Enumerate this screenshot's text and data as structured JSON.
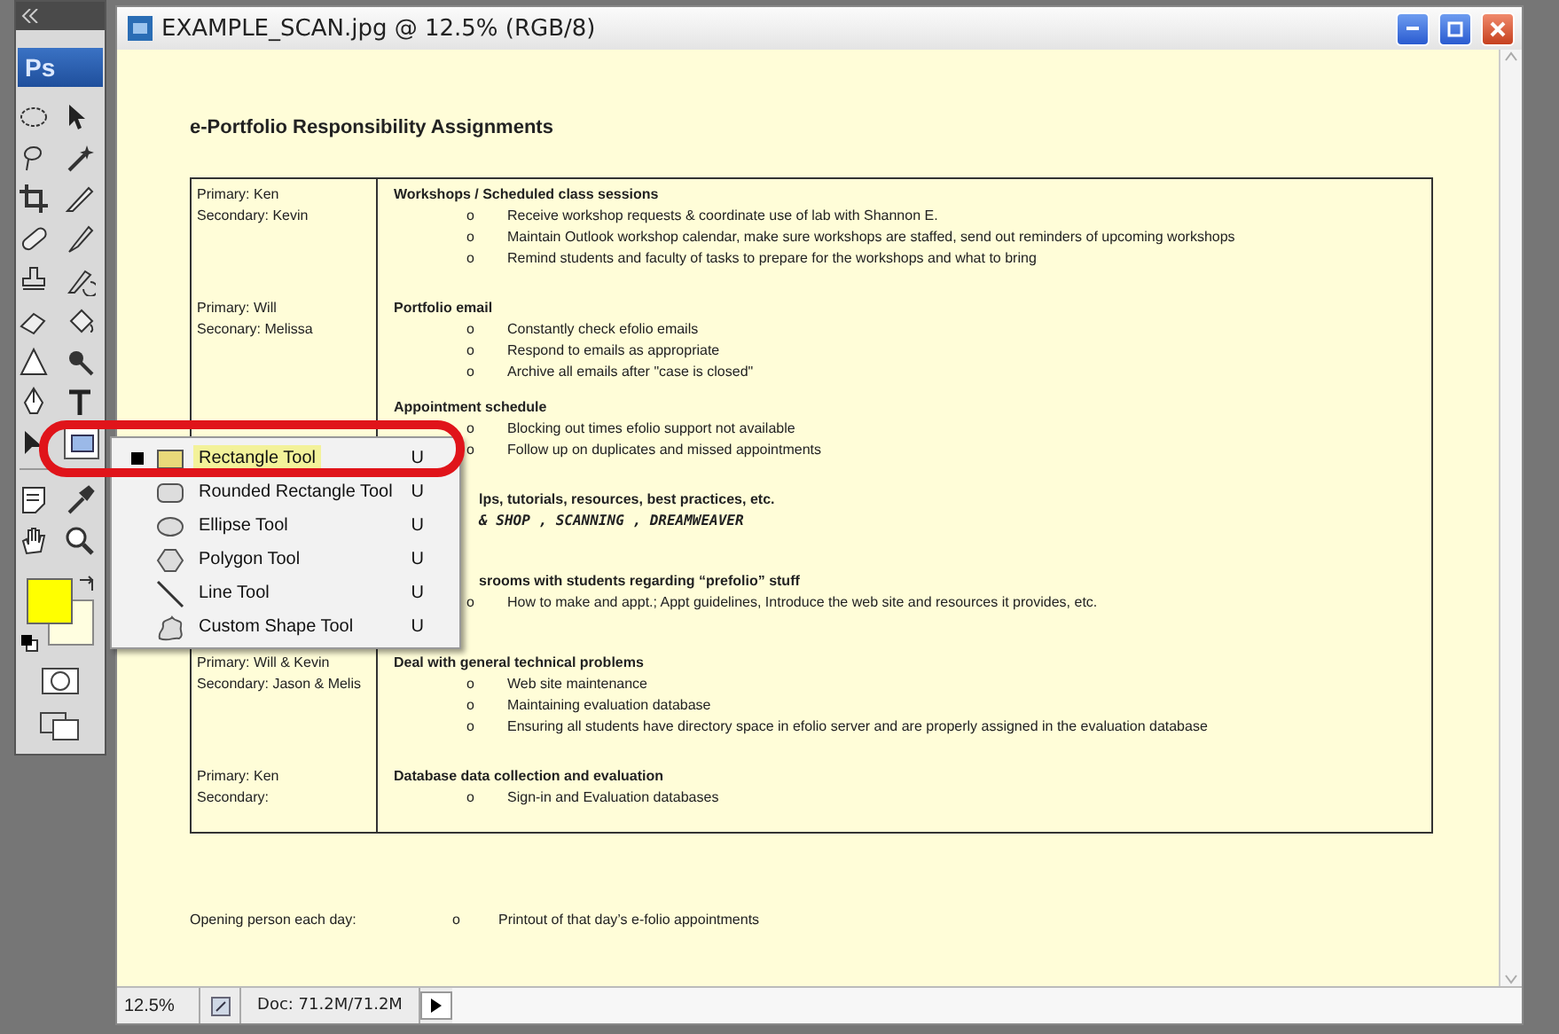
{
  "toolbox": {
    "logo": "Ps"
  },
  "window": {
    "title": "EXAMPLE_SCAN.jpg @ 12.5% (RGB/8)"
  },
  "document": {
    "title": "e-Portfolio Responsibility Assignments",
    "rows": [
      {
        "primary": "Primary: Ken",
        "secondary": "Secondary: Kevin",
        "heading": "Workshops / Scheduled class sessions",
        "kind": "full",
        "bullets": [
          {
            "mark": "o",
            "text": "Receive workshop requests & coordinate use of lab with Shannon E."
          },
          {
            "mark": "o",
            "text": "Maintain Outlook workshop calendar, make sure workshops are staffed, send out reminders of upcoming workshops"
          },
          {
            "mark": "o",
            "text": "Remind students and faculty of tasks to prepare for the workshops and what to bring"
          }
        ]
      },
      {
        "primary": "Primary:  Will",
        "secondary": "Seconary: Melissa",
        "heading": "Portfolio email",
        "kind": "full",
        "bullets": [
          {
            "mark": "o",
            "text": "Constantly check efolio emails"
          },
          {
            "mark": "o",
            "text": "Respond to emails as appropriate"
          },
          {
            "mark": "o",
            "text": "Archive all emails after \"case is closed\""
          }
        ]
      },
      {
        "heading": "Appointment schedule",
        "kind": "full",
        "bullets": [
          {
            "mark": "o",
            "text": "Blocking out times efolio support not available"
          },
          {
            "mark": "o",
            "text": "Follow up on duplicates and missed appointments"
          }
        ]
      },
      {
        "heading": "lps, tutorials, resources, best practices, etc.",
        "kind": "covered",
        "note": "& SHOP ,  SCANNING , DREAMWEAVER",
        "bullets": []
      },
      {
        "heading": "srooms with students regarding “prefolio” stuff",
        "kind": "covered",
        "bullets": [
          {
            "mark": "o",
            "text": "How to make and appt.; Appt guidelines, Introduce the web site and resources it provides, etc."
          }
        ]
      },
      {
        "primary": "Primary: Will & Kevin",
        "secondary": "Secondary: Jason & Melis",
        "heading": "Deal with general  technical problems",
        "kind": "full",
        "bullets": [
          {
            "mark": "o",
            "text": "Web site maintenance"
          },
          {
            "mark": "o",
            "text": "Maintaining evaluation database"
          },
          {
            "mark": "o",
            "text": "Ensuring all students have directory space in efolio server and are properly assigned in the evaluation database"
          }
        ]
      },
      {
        "primary": "Primary: Ken",
        "secondary": "Secondary:",
        "heading": "Database data collection and evaluation",
        "kind": "full",
        "bullets": [
          {
            "mark": "o",
            "text": "Sign-in and Evaluation databases"
          }
        ]
      }
    ],
    "footer_label": "Opening person each day:",
    "footer_bullet": {
      "mark": "o",
      "text": "Printout of that day’s e-folio appointments"
    }
  },
  "status_bar": {
    "zoom": "12.5%",
    "doc_size": "Doc: 71.2M/71.2M"
  },
  "flyout_menu": {
    "items": [
      {
        "label": "Rectangle Tool",
        "shortcut": "U",
        "selected": true
      },
      {
        "label": "Rounded Rectangle Tool",
        "shortcut": "U",
        "selected": false
      },
      {
        "label": "Ellipse Tool",
        "shortcut": "U",
        "selected": false
      },
      {
        "label": "Polygon Tool",
        "shortcut": "U",
        "selected": false
      },
      {
        "label": "Line Tool",
        "shortcut": "U",
        "selected": false
      },
      {
        "label": "Custom Shape Tool",
        "shortcut": "U",
        "selected": false
      }
    ]
  }
}
